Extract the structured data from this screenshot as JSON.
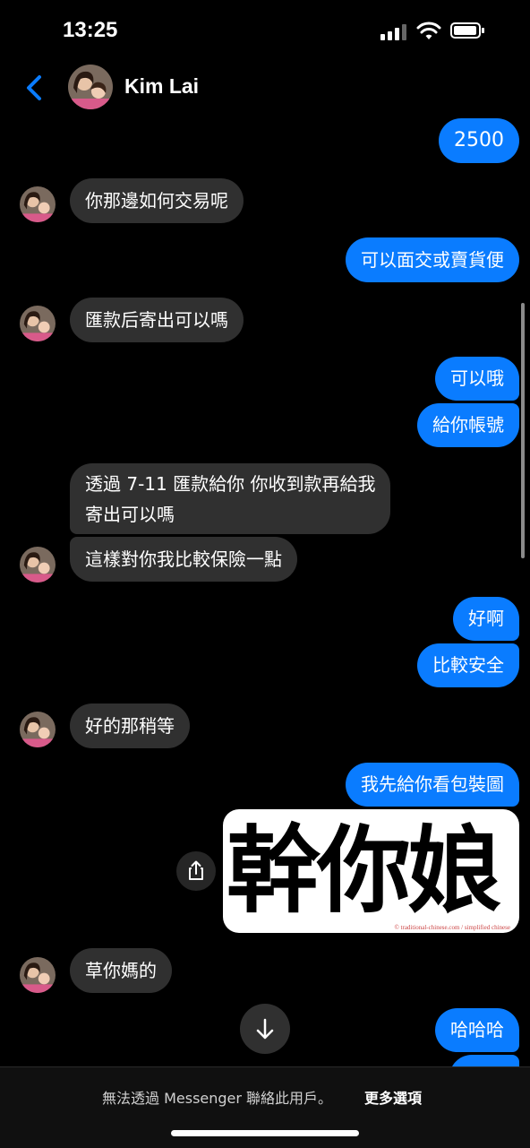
{
  "status_bar": {
    "time": "13:25"
  },
  "header": {
    "contact_name": "Kim Lai"
  },
  "messages": [
    {
      "dir": "out",
      "text": "2500"
    },
    {
      "dir": "in",
      "text": "你那邊如何交易呢"
    },
    {
      "dir": "out",
      "text": "可以面交或賣貨便"
    },
    {
      "dir": "in",
      "text": "匯款后寄出可以嗎"
    },
    {
      "dir": "out",
      "text": "可以哦"
    },
    {
      "dir": "out",
      "text": "給你帳號"
    },
    {
      "dir": "in",
      "text_line1": "透過 7-11 匯款給你 你收到款再給我",
      "text_line2": "寄出可以嗎"
    },
    {
      "dir": "in",
      "text": "這樣對你我比較保險一點"
    },
    {
      "dir": "out",
      "text": "好啊"
    },
    {
      "dir": "out",
      "text": "比較安全"
    },
    {
      "dir": "in",
      "text": "好的那稍等"
    },
    {
      "dir": "out",
      "text": "我先給你看包裝圖"
    },
    {
      "dir": "out",
      "type": "image",
      "image_text": "幹你娘",
      "image_caption": "© traditional-chinese.com / simplified chinese"
    },
    {
      "dir": "in",
      "text": "草你媽的"
    },
    {
      "dir": "out",
      "text": "哈哈哈"
    }
  ],
  "footer": {
    "notice": "無法透過 Messenger 聯絡此用戶。",
    "more_options": "更多選項"
  },
  "colors": {
    "outgoing_bubble": "#0a7cff",
    "incoming_bubble": "#303030",
    "accent": "#0a7cff"
  }
}
